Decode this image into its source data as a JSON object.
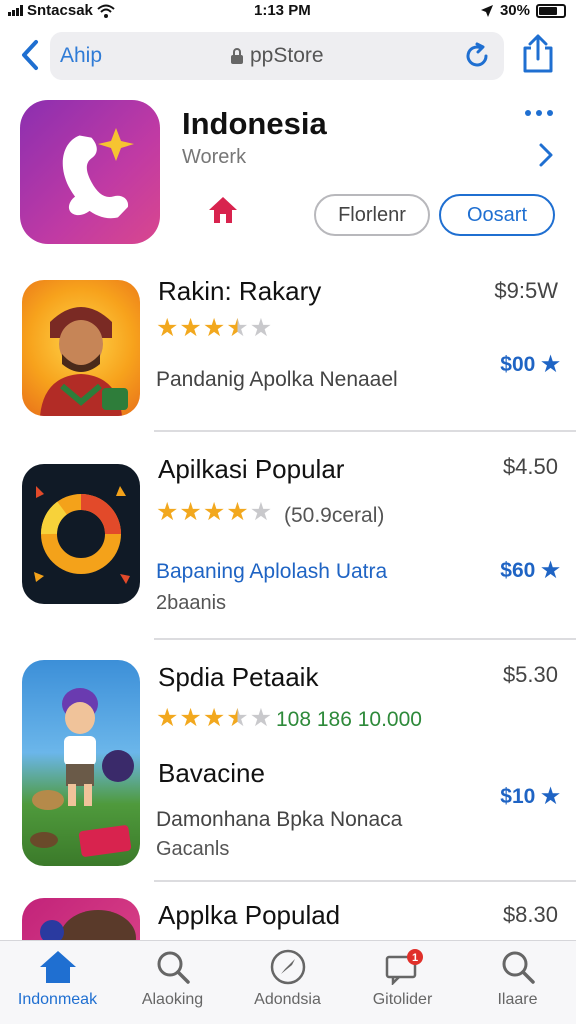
{
  "status": {
    "carrier": "Sntacsak",
    "time": "1:13 PM",
    "battery": "30%"
  },
  "browser": {
    "left_label": "Ahip",
    "url": "ppStore"
  },
  "header": {
    "title": "Indonesia",
    "subtitle": "Worerk",
    "button_plain": "Florlenr",
    "button_blue": "Oosart"
  },
  "apps": [
    {
      "name": "Rakin: Rakary",
      "price": "$9:5W",
      "rating": 3.5,
      "description": "Pandanig Apolka Nenaael",
      "pricestar": "$00 ★"
    },
    {
      "name": "Apilkasi Popular",
      "price": "$4.50",
      "rating": 4,
      "rating_count": "(50.9ceral)",
      "description": "Bapaning Aplolash Uatra",
      "subtext": "2baanis",
      "pricestar": "$60 ★"
    },
    {
      "name": "Spdia Petaaik",
      "price": "$5.30",
      "rating": 3.5,
      "rating_count": "108 186 10.000",
      "secondary_title": "Bavacine",
      "description": "Damonhana Bpka Nonaca",
      "subtext": "Gacanls",
      "pricestar": "$10 ★"
    },
    {
      "name": "Applka Populad",
      "price": "$8.30"
    }
  ],
  "tabs": [
    {
      "label": "Indonmeak",
      "icon": "home-icon"
    },
    {
      "label": "Alaoking",
      "icon": "search-icon"
    },
    {
      "label": "Adondsia",
      "icon": "compass-icon"
    },
    {
      "label": "Gitolider",
      "icon": "messages-icon",
      "badge": "1"
    },
    {
      "label": "Ilaare",
      "icon": "search-icon"
    }
  ],
  "colors": {
    "accent": "#1f6fd1",
    "star": "#f2a81e",
    "icon_purple": "#a335aa"
  }
}
